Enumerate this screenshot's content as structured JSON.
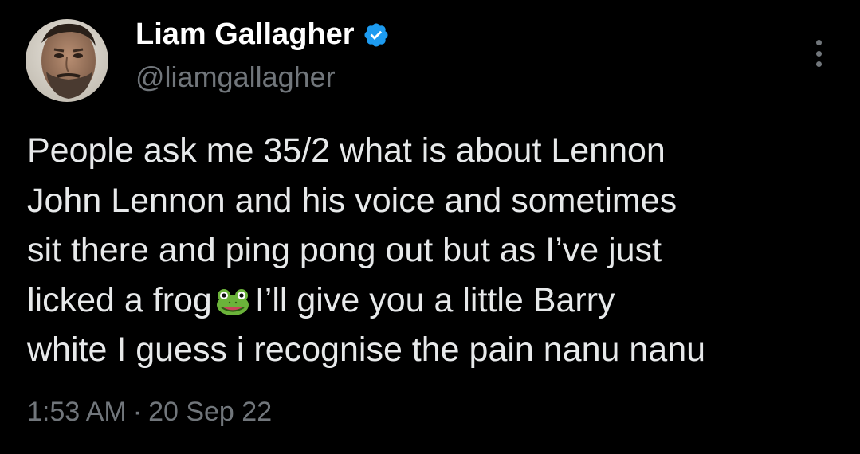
{
  "author": {
    "display_name": "Liam Gallagher",
    "handle": "@liamgallagher",
    "verified": true,
    "verified_color": "#1d9bf0"
  },
  "tweet": {
    "lines": [
      "People ask me 35/2 what is about Lennon",
      "John Lennon and his voice and sometimes",
      "sit there and ping pong out but as I’ve just",
      "licked a frog",
      "I’ll give you a little Barry",
      "white I guess i recognise the pain nanu nanu"
    ],
    "emoji": "frog-face-icon"
  },
  "meta": {
    "time": "1:53 AM",
    "separator": "·",
    "date": "20 Sep 22"
  },
  "colors": {
    "background": "#000000",
    "text": "#e7e9ea",
    "secondary": "#71767b"
  }
}
